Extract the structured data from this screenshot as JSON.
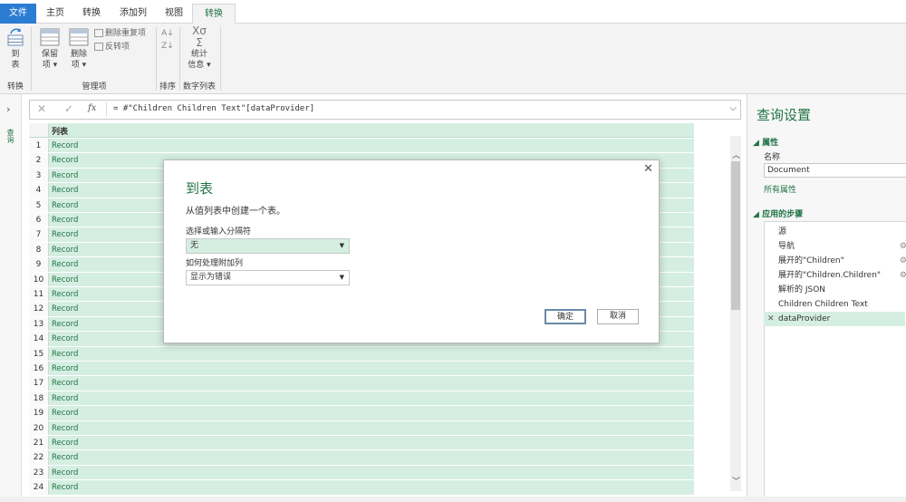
{
  "tabs": {
    "file": "文件",
    "home": "主页",
    "transform": "转换",
    "add_column": "添加列",
    "view": "视图",
    "active": "转换"
  },
  "ribbon": {
    "to_table": "到\n表",
    "to_table_line1": "到",
    "to_table_line2": "表",
    "group_transform": "转换",
    "keep_line1": "保留",
    "keep_line2": "项",
    "remove_line1": "删除",
    "remove_line2": "项",
    "remove_duplicates": "删除重复项",
    "reverse_items": "反转项",
    "group_manage": "管理项",
    "group_sort": "排序",
    "stats_line1": "统计",
    "stats_line2": "信息",
    "group_numeric": "数字列表"
  },
  "leftnav": {
    "label": "查询"
  },
  "formula": {
    "fx": "fx",
    "text": "= #\"Children Children Text\"[dataProvider]"
  },
  "grid": {
    "header": "列表",
    "rows": [
      "1",
      "2",
      "3",
      "4",
      "5",
      "6",
      "7",
      "8",
      "9",
      "10",
      "11",
      "12",
      "13",
      "14",
      "15",
      "16",
      "17",
      "18",
      "19",
      "20",
      "21",
      "22",
      "23",
      "24"
    ],
    "cell_value": "Record"
  },
  "panel": {
    "title": "查询设置",
    "properties": "属性",
    "name_label": "名称",
    "name_value": "Document",
    "all_properties": "所有属性",
    "applied_steps": "应用的步骤",
    "steps": [
      "源",
      "导航",
      "展开的\"Children\"",
      "展开的\"Children.Children\"",
      "解析的 JSON",
      "Children Children Text",
      "dataProvider"
    ]
  },
  "dialog": {
    "title": "到表",
    "subtitle": "从值列表中创建一个表。",
    "delimiter_label": "选择或输入分隔符",
    "delimiter_value": "无",
    "extra_label": "如何处理附加列",
    "extra_value": "显示为错误",
    "ok": "确定",
    "cancel": "取消"
  },
  "colors": {
    "accent": "#217346",
    "file_tab": "#2b7cd3",
    "row_fill": "#d5eee2"
  }
}
